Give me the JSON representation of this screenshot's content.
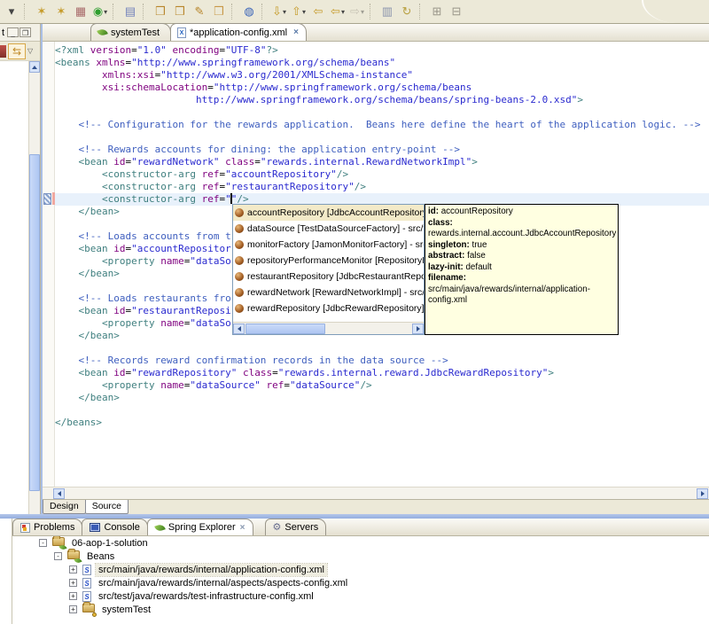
{
  "colors": {
    "chrome_bg": "#ECE9D8",
    "active_part_border": "#94AEDE",
    "tooltip_bg": "#FFFFE1",
    "selection_tan": "#F3EAC8",
    "current_line": "#E8F1FB",
    "xml_tag": "#3F7F7F",
    "xml_attr": "#7F007F",
    "xml_value": "#2A2ACF",
    "xml_comment": "#3F5FBF"
  },
  "ui": {
    "caret_glyph": "▾",
    "close_glyph": "×",
    "minimize_glyph": "_",
    "maximize_glyph": "❒"
  },
  "toolbar": {
    "items": [
      {
        "name": "toolbar-caret",
        "glyph": "▾",
        "color": "#444444",
        "flat": true
      },
      {
        "sep": true
      },
      {
        "name": "new-bean-wizard",
        "glyph": "✶",
        "color": "#C59A28"
      },
      {
        "name": "new-class-wizard",
        "glyph": "✶",
        "color": "#C59A28"
      },
      {
        "name": "plugin",
        "glyph": "▦",
        "color": "#A86A6A"
      },
      {
        "name": "run",
        "glyph": "◉",
        "color": "#2E9E2E",
        "caret": true
      },
      {
        "sep": true
      },
      {
        "name": "show-view",
        "glyph": "▤",
        "color": "#7282BC"
      },
      {
        "sep": true
      },
      {
        "name": "open-type",
        "glyph": "❒",
        "color": "#B8862C"
      },
      {
        "name": "open-resource",
        "glyph": "❒",
        "color": "#B8862C"
      },
      {
        "name": "annotate",
        "glyph": "✎",
        "color": "#B8862C"
      },
      {
        "name": "open-folder",
        "glyph": "❒",
        "color": "#C89848"
      },
      {
        "sep": true
      },
      {
        "name": "web-browser",
        "glyph": "◍",
        "color": "#3A64B8"
      },
      {
        "sep": true
      },
      {
        "name": "next-annotation",
        "glyph": "⇩",
        "color": "#C59A28",
        "caret": true
      },
      {
        "name": "previous-annotation",
        "glyph": "⇧",
        "color": "#C59A28",
        "caret": true
      },
      {
        "name": "last-edit-location",
        "glyph": "⇦",
        "color": "#C59A28"
      },
      {
        "name": "back-history",
        "glyph": "⇦",
        "color": "#C59A28",
        "caret": true
      },
      {
        "name": "forward-history",
        "glyph": "⇨",
        "color": "#9A968A",
        "caret": true,
        "dim": true
      },
      {
        "sep": true
      },
      {
        "name": "pin-editor",
        "glyph": "▥",
        "color": "#8A94AC"
      },
      {
        "name": "editor-history",
        "glyph": "↻",
        "color": "#B8A040"
      },
      {
        "sep": true
      },
      {
        "name": "expand-all",
        "glyph": "⊞",
        "color": "#9A968A"
      },
      {
        "name": "collapse-all",
        "glyph": "⊟",
        "color": "#9A968A"
      }
    ]
  },
  "left_panel": {
    "tab_label": "t"
  },
  "editor": {
    "tabs": [
      {
        "label": "systemTest",
        "icon": "leaf",
        "active": false,
        "closable": false
      },
      {
        "label": "*application-config.xml",
        "icon": "xmlfile",
        "active": true,
        "closable": true
      }
    ],
    "bottom_tabs": [
      {
        "label": "Design",
        "active": false
      },
      {
        "label": "Source",
        "active": true
      }
    ],
    "code_lines": [
      {
        "seg": [
          [
            "st",
            "<?xml "
          ],
          [
            "sa",
            "version"
          ],
          [
            "sp",
            "="
          ],
          [
            "sv",
            "\"1.0\""
          ],
          [
            "sp",
            " "
          ],
          [
            "sa",
            "encoding"
          ],
          [
            "sp",
            "="
          ],
          [
            "sv",
            "\"UTF-8\""
          ],
          [
            "st",
            "?>"
          ]
        ]
      },
      {
        "seg": [
          [
            "st",
            "<beans "
          ],
          [
            "sa",
            "xmlns"
          ],
          [
            "sp",
            "="
          ],
          [
            "sv",
            "\"http://www.springframework.org/schema/beans\""
          ]
        ]
      },
      {
        "seg": [
          [
            "sp",
            "        "
          ],
          [
            "sa",
            "xmlns:xsi"
          ],
          [
            "sp",
            "="
          ],
          [
            "sv",
            "\"http://www.w3.org/2001/XMLSchema-instance\""
          ]
        ]
      },
      {
        "seg": [
          [
            "sp",
            "        "
          ],
          [
            "sa",
            "xsi:schemaLocation"
          ],
          [
            "sp",
            "="
          ],
          [
            "sv",
            "\"http://www.springframework.org/schema/beans"
          ]
        ]
      },
      {
        "seg": [
          [
            "sv",
            "                        http://www.springframework.org/schema/beans/spring-beans-2.0.xsd\""
          ],
          [
            "st",
            ">"
          ]
        ]
      },
      {
        "seg": []
      },
      {
        "seg": [
          [
            "sp",
            "    "
          ],
          [
            "sc",
            "<!-- Configuration for the rewards application.  Beans here define the heart of the application logic. -->"
          ]
        ]
      },
      {
        "seg": []
      },
      {
        "seg": [
          [
            "sp",
            "    "
          ],
          [
            "sc",
            "<!-- Rewards accounts for dining: the application entry-point -->"
          ]
        ]
      },
      {
        "seg": [
          [
            "sp",
            "    "
          ],
          [
            "st",
            "<bean "
          ],
          [
            "sa",
            "id"
          ],
          [
            "sp",
            "="
          ],
          [
            "sv",
            "\"rewardNetwork\""
          ],
          [
            "sp",
            " "
          ],
          [
            "sa",
            "class"
          ],
          [
            "sp",
            "="
          ],
          [
            "sv",
            "\"rewards.internal.RewardNetworkImpl\""
          ],
          [
            "st",
            ">"
          ]
        ]
      },
      {
        "seg": [
          [
            "sp",
            "        "
          ],
          [
            "st",
            "<constructor-arg "
          ],
          [
            "sa",
            "ref"
          ],
          [
            "sp",
            "="
          ],
          [
            "sv",
            "\"accountRepository\""
          ],
          [
            "st",
            "/>"
          ]
        ]
      },
      {
        "seg": [
          [
            "sp",
            "        "
          ],
          [
            "st",
            "<constructor-arg "
          ],
          [
            "sa",
            "ref"
          ],
          [
            "sp",
            "="
          ],
          [
            "sv",
            "\"restaurantRepository\""
          ],
          [
            "st",
            "/>"
          ]
        ]
      },
      {
        "current": true,
        "seg": [
          [
            "sp",
            "        "
          ],
          [
            "st",
            "<constructor-arg "
          ],
          [
            "sa",
            "ref"
          ],
          [
            "sp",
            "="
          ],
          [
            "sv",
            "\""
          ],
          [
            "cur",
            ""
          ],
          [
            "sv",
            "\""
          ],
          [
            "st",
            "/>"
          ]
        ]
      },
      {
        "seg": [
          [
            "sp",
            "    "
          ],
          [
            "st",
            "</bean>"
          ]
        ]
      },
      {
        "seg": []
      },
      {
        "seg": [
          [
            "sp",
            "    "
          ],
          [
            "sc",
            "<!-- Loads accounts from t"
          ]
        ]
      },
      {
        "seg": [
          [
            "sp",
            "    "
          ],
          [
            "st",
            "<bean "
          ],
          [
            "sa",
            "id"
          ],
          [
            "sp",
            "="
          ],
          [
            "sv",
            "\"accountRepositor"
          ]
        ]
      },
      {
        "seg": [
          [
            "sp",
            "        "
          ],
          [
            "st",
            "<property "
          ],
          [
            "sa",
            "name"
          ],
          [
            "sp",
            "="
          ],
          [
            "sv",
            "\"dataSo"
          ]
        ]
      },
      {
        "seg": [
          [
            "sp",
            "    "
          ],
          [
            "st",
            "</bean>"
          ]
        ]
      },
      {
        "seg": []
      },
      {
        "seg": [
          [
            "sp",
            "    "
          ],
          [
            "sc",
            "<!-- Loads restaurants fro"
          ]
        ]
      },
      {
        "seg": [
          [
            "sp",
            "    "
          ],
          [
            "st",
            "<bean "
          ],
          [
            "sa",
            "id"
          ],
          [
            "sp",
            "="
          ],
          [
            "sv",
            "\"restaurantReposi"
          ]
        ]
      },
      {
        "seg": [
          [
            "sp",
            "        "
          ],
          [
            "st",
            "<property "
          ],
          [
            "sa",
            "name"
          ],
          [
            "sp",
            "="
          ],
          [
            "sv",
            "\"dataSo"
          ]
        ]
      },
      {
        "seg": [
          [
            "sp",
            "    "
          ],
          [
            "st",
            "</bean>"
          ]
        ]
      },
      {
        "seg": []
      },
      {
        "seg": [
          [
            "sp",
            "    "
          ],
          [
            "sc",
            "<!-- Records reward confirmation records in the data source -->"
          ]
        ]
      },
      {
        "seg": [
          [
            "sp",
            "    "
          ],
          [
            "st",
            "<bean "
          ],
          [
            "sa",
            "id"
          ],
          [
            "sp",
            "="
          ],
          [
            "sv",
            "\"rewardRepository\""
          ],
          [
            "sp",
            " "
          ],
          [
            "sa",
            "class"
          ],
          [
            "sp",
            "="
          ],
          [
            "sv",
            "\"rewards.internal.reward.JdbcRewardRepository\""
          ],
          [
            "st",
            ">"
          ]
        ]
      },
      {
        "seg": [
          [
            "sp",
            "        "
          ],
          [
            "st",
            "<property "
          ],
          [
            "sa",
            "name"
          ],
          [
            "sp",
            "="
          ],
          [
            "sv",
            "\"dataSource\""
          ],
          [
            "sp",
            " "
          ],
          [
            "sa",
            "ref"
          ],
          [
            "sp",
            "="
          ],
          [
            "sv",
            "\"dataSource\""
          ],
          [
            "st",
            "/>"
          ]
        ]
      },
      {
        "seg": [
          [
            "sp",
            "    "
          ],
          [
            "st",
            "</bean>"
          ]
        ]
      },
      {
        "seg": []
      },
      {
        "seg": [
          [
            "st",
            "</beans>"
          ]
        ]
      }
    ]
  },
  "autocomplete": {
    "selected_index": 0,
    "items": [
      "accountRepository [JdbcAccountRepository] - src/",
      "dataSource [TestDataSourceFactory] - src/test/ja",
      "monitorFactory [JamonMonitorFactory] - src/main",
      "repositoryPerformanceMonitor [RepositoryPerform",
      "restaurantRepository [JdbcRestaurantRepository]",
      "rewardNetwork [RewardNetworkImpl] - src/main/j",
      "rewardRepository [JdbcRewardRepository] - src/r"
    ],
    "tooltip": {
      "lines": [
        [
          "id:",
          " accountRepository"
        ],
        [
          "class:",
          ""
        ],
        [
          "",
          " rewards.internal.account.JdbcAccountRepository"
        ],
        [
          "singleton:",
          " true"
        ],
        [
          "abstract:",
          " false"
        ],
        [
          "lazy-init:",
          " default"
        ],
        [
          "filename:",
          " src/main/java/rewards/internal/application-"
        ],
        [
          "",
          " config.xml"
        ]
      ]
    }
  },
  "panel": {
    "tabs": [
      {
        "label": "Problems",
        "icon": "problems",
        "active": false
      },
      {
        "label": "Console",
        "icon": "console",
        "active": false
      },
      {
        "label": "Spring Explorer",
        "icon": "leaf",
        "active": true,
        "closable": true
      },
      {
        "label": "Servers",
        "icon": "servers",
        "active": false,
        "gap_before": true
      }
    ]
  },
  "explorer": {
    "tree": [
      {
        "indent": 0,
        "expander": "-",
        "icon": "project",
        "label": "06-aop-1-solution",
        "selected": false
      },
      {
        "indent": 1,
        "expander": "-",
        "icon": "beans",
        "label": "Beans",
        "selected": false
      },
      {
        "indent": 2,
        "expander": "+",
        "icon": "config",
        "label": "src/main/java/rewards/internal/application-config.xml",
        "selected": true
      },
      {
        "indent": 2,
        "expander": "+",
        "icon": "config",
        "label": "src/main/java/rewards/internal/aspects/aspects-config.xml",
        "selected": false
      },
      {
        "indent": 2,
        "expander": "+",
        "icon": "config",
        "label": "src/test/java/rewards/test-infrastructure-config.xml",
        "selected": false
      },
      {
        "indent": 2,
        "expander": "+",
        "icon": "folder",
        "label": "systemTest",
        "selected": false
      }
    ]
  }
}
